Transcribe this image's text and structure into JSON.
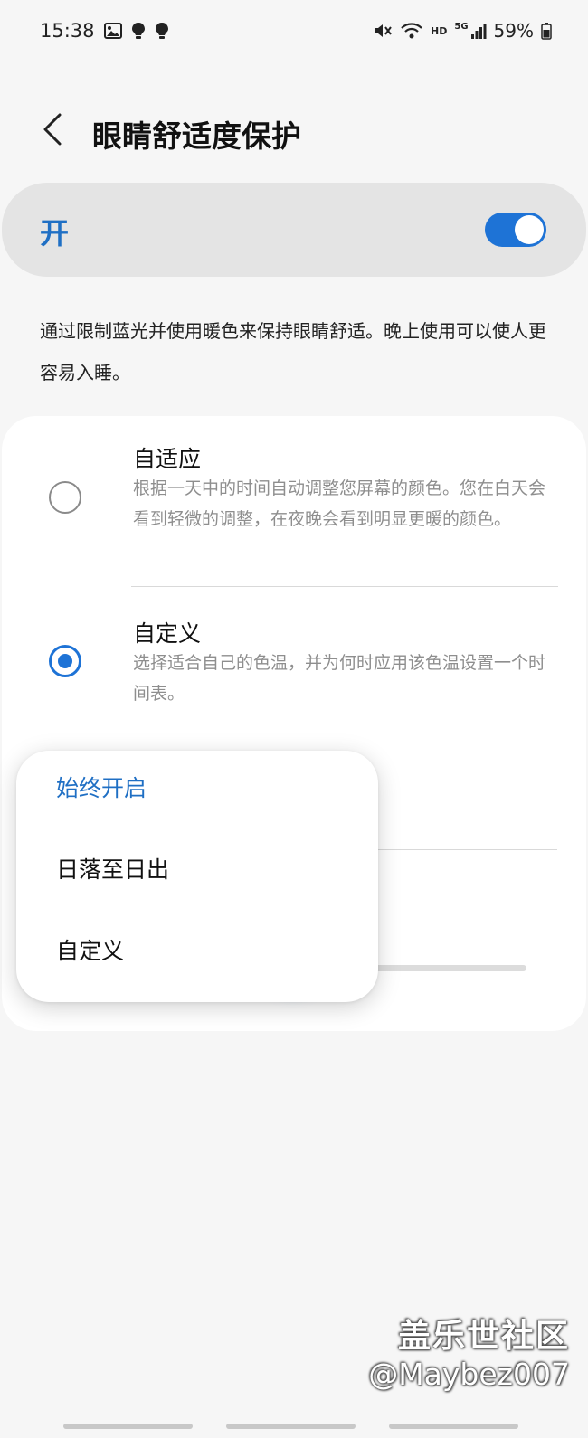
{
  "status_bar": {
    "time": "15:38",
    "battery": "59%",
    "network_label": "HD",
    "signal_label": "5G"
  },
  "header": {
    "title": "眼睛舒适度保护"
  },
  "master_switch": {
    "label": "开",
    "state": "on"
  },
  "description": "通过限制蓝光并使用暖色来保持眼睛舒适。晚上使用可以使人更容易入睡。",
  "options": [
    {
      "title": "自适应",
      "description": "根据一天中的时间自动调整您屏幕的颜色。您在白天会看到轻微的调整，在夜晚会看到明显更暖的颜色。",
      "selected": false
    },
    {
      "title": "自定义",
      "description": "选择适合自己的色温，并为何时应用该色温设置一个时间表。",
      "selected": true
    }
  ],
  "schedule_popup": {
    "items": [
      "始终开启",
      "日落至日出",
      "自定义"
    ],
    "selected_index": 0
  },
  "watermark": {
    "line1": "盖乐世社区",
    "line2": "@Maybez007"
  },
  "colors": {
    "accent": "#1e73d6",
    "accent_text": "#1f6fc4",
    "background": "#f6f6f6",
    "card": "#ffffff"
  }
}
